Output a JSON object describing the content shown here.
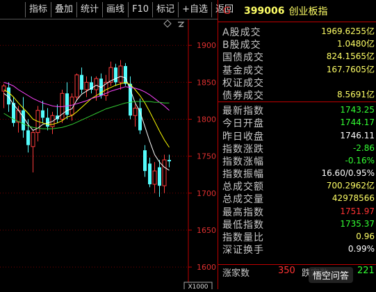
{
  "toolbar": {
    "buttons": [
      "指标",
      "叠加",
      "统计",
      "画线",
      "F10",
      "标记",
      "+自选",
      "返回"
    ]
  },
  "chart_data": {
    "type": "candlestick",
    "yticks": [
      1900,
      1850,
      1800,
      1750,
      1700,
      1650,
      1600
    ],
    "ylim": [
      1570,
      1935
    ],
    "zoom_label": "X1000",
    "candles": [
      {
        "o": 1838,
        "h": 1848,
        "l": 1815,
        "c": 1845
      },
      {
        "o": 1843,
        "h": 1850,
        "l": 1810,
        "c": 1820
      },
      {
        "o": 1822,
        "h": 1830,
        "l": 1790,
        "c": 1795
      },
      {
        "o": 1796,
        "h": 1818,
        "l": 1782,
        "c": 1812
      },
      {
        "o": 1812,
        "h": 1830,
        "l": 1775,
        "c": 1785
      },
      {
        "o": 1785,
        "h": 1800,
        "l": 1755,
        "c": 1765
      },
      {
        "o": 1763,
        "h": 1785,
        "l": 1728,
        "c": 1782
      },
      {
        "o": 1782,
        "h": 1818,
        "l": 1770,
        "c": 1812
      },
      {
        "o": 1812,
        "h": 1825,
        "l": 1795,
        "c": 1802
      },
      {
        "o": 1802,
        "h": 1815,
        "l": 1785,
        "c": 1790
      },
      {
        "o": 1790,
        "h": 1810,
        "l": 1780,
        "c": 1805
      },
      {
        "o": 1805,
        "h": 1820,
        "l": 1795,
        "c": 1800
      },
      {
        "o": 1800,
        "h": 1840,
        "l": 1795,
        "c": 1835
      },
      {
        "o": 1835,
        "h": 1850,
        "l": 1800,
        "c": 1806
      },
      {
        "o": 1806,
        "h": 1835,
        "l": 1798,
        "c": 1830
      },
      {
        "o": 1830,
        "h": 1862,
        "l": 1825,
        "c": 1860
      },
      {
        "o": 1860,
        "h": 1870,
        "l": 1835,
        "c": 1840
      },
      {
        "o": 1840,
        "h": 1858,
        "l": 1830,
        "c": 1850
      },
      {
        "o": 1850,
        "h": 1858,
        "l": 1835,
        "c": 1840
      },
      {
        "o": 1840,
        "h": 1858,
        "l": 1825,
        "c": 1855
      },
      {
        "o": 1855,
        "h": 1862,
        "l": 1828,
        "c": 1832
      },
      {
        "o": 1832,
        "h": 1860,
        "l": 1825,
        "c": 1850
      },
      {
        "o": 1850,
        "h": 1878,
        "l": 1845,
        "c": 1870
      },
      {
        "o": 1870,
        "h": 1875,
        "l": 1845,
        "c": 1850
      },
      {
        "o": 1850,
        "h": 1880,
        "l": 1840,
        "c": 1872
      },
      {
        "o": 1872,
        "h": 1876,
        "l": 1845,
        "c": 1848
      },
      {
        "o": 1848,
        "h": 1858,
        "l": 1800,
        "c": 1805
      },
      {
        "o": 1805,
        "h": 1820,
        "l": 1790,
        "c": 1815
      },
      {
        "o": 1815,
        "h": 1828,
        "l": 1780,
        "c": 1785
      },
      {
        "o": 1758,
        "h": 1765,
        "l": 1722,
        "c": 1730
      },
      {
        "o": 1740,
        "h": 1748,
        "l": 1708,
        "c": 1712
      },
      {
        "o": 1712,
        "h": 1742,
        "l": 1700,
        "c": 1730
      },
      {
        "o": 1735,
        "h": 1745,
        "l": 1695,
        "c": 1710
      },
      {
        "o": 1710,
        "h": 1752,
        "l": 1700,
        "c": 1745
      },
      {
        "o": 1745,
        "h": 1752,
        "l": 1735,
        "c": 1743
      }
    ],
    "ma_lines": [
      {
        "name": "MA5",
        "color": "#ffffff",
        "values": [
          1835,
          1830,
          1820,
          1812,
          1803,
          1793,
          1785,
          1788,
          1793,
          1795,
          1797,
          1802,
          1807,
          1812,
          1814,
          1826,
          1834,
          1838,
          1842,
          1846,
          1843,
          1848,
          1852,
          1855,
          1858,
          1856,
          1840,
          1822,
          1810,
          1790,
          1770,
          1752,
          1742,
          1735,
          1731
        ]
      },
      {
        "name": "MA10",
        "color": "#ffff00",
        "values": [
          1840,
          1836,
          1830,
          1822,
          1815,
          1808,
          1800,
          1797,
          1795,
          1793,
          1793,
          1795,
          1798,
          1803,
          1805,
          1810,
          1816,
          1822,
          1828,
          1832,
          1836,
          1840,
          1843,
          1846,
          1848,
          1850,
          1847,
          1840,
          1832,
          1822,
          1810,
          1797,
          1784,
          1772,
          1762
        ]
      },
      {
        "name": "MA20",
        "color": "#ff44ff",
        "values": [
          1850,
          1848,
          1845,
          1840,
          1836,
          1832,
          1828,
          1825,
          1822,
          1820,
          1818,
          1817,
          1817,
          1818,
          1819,
          1821,
          1823,
          1825,
          1828,
          1830,
          1832,
          1835,
          1838,
          1840,
          1842,
          1844,
          1843,
          1842,
          1840,
          1837,
          1833,
          1828,
          1823,
          1818,
          1812
        ]
      },
      {
        "name": "MA60",
        "color": "#33cc33",
        "values": [
          1808,
          1804,
          1800,
          1797,
          1794,
          1791,
          1789,
          1788,
          1787,
          1787,
          1787,
          1788,
          1789,
          1791,
          1793,
          1796,
          1799,
          1802,
          1805,
          1808,
          1811,
          1814,
          1816,
          1818,
          1820,
          1822,
          1823,
          1824,
          1824,
          1824,
          1824,
          1823,
          1823,
          1822,
          1822
        ]
      }
    ]
  },
  "panel": {
    "flag": "G",
    "code": "399006",
    "name": "创业板指",
    "group1": [
      {
        "label": "A股成交",
        "value": "1969.6255亿",
        "color": "#ffff66"
      },
      {
        "label": "B股成交",
        "value": "1.0480亿",
        "color": "#ffff66"
      },
      {
        "label": "国债成交",
        "value": "824.1565亿",
        "color": "#ffff66"
      },
      {
        "label": "基金成交",
        "value": "167.7605亿",
        "color": "#ffff66"
      },
      {
        "label": "权证成交",
        "value": "",
        "color": "#ffff66"
      },
      {
        "label": "债券成交",
        "value": "8.5691亿",
        "color": "#ffff66"
      }
    ],
    "group2": [
      {
        "label": "最新指数",
        "value": "1743.25",
        "color": "#33ff33"
      },
      {
        "label": "今日开盘",
        "value": "1744.17",
        "color": "#33ff33"
      },
      {
        "label": "昨日收盘",
        "value": "1746.11",
        "color": "#ffffff"
      },
      {
        "label": "指数涨跌",
        "value": "-2.86",
        "color": "#33ff33"
      },
      {
        "label": "指数涨幅",
        "value": "-0.16%",
        "color": "#33ff33"
      },
      {
        "label": "指数振幅",
        "value": "16.60/0.95%",
        "color": "#ffffff"
      },
      {
        "label": "总成交额",
        "value": "700.2962亿",
        "color": "#ffff66"
      },
      {
        "label": "总成交量",
        "value": "42978566",
        "color": "#ffff66"
      },
      {
        "label": "最高指数",
        "value": "1751.97",
        "color": "#ff3333"
      },
      {
        "label": "最低指数",
        "value": "1735.37",
        "color": "#33ff33"
      },
      {
        "label": "指数量比",
        "value": "0.96",
        "color": "#ffff66"
      },
      {
        "label": "深证换手",
        "value": "0.99%",
        "color": "#ffffff"
      }
    ],
    "bottom": {
      "label": "涨家数",
      "value": "350",
      "label2": "跌家数",
      "value2": "221"
    }
  },
  "watermark": "悟空问答"
}
